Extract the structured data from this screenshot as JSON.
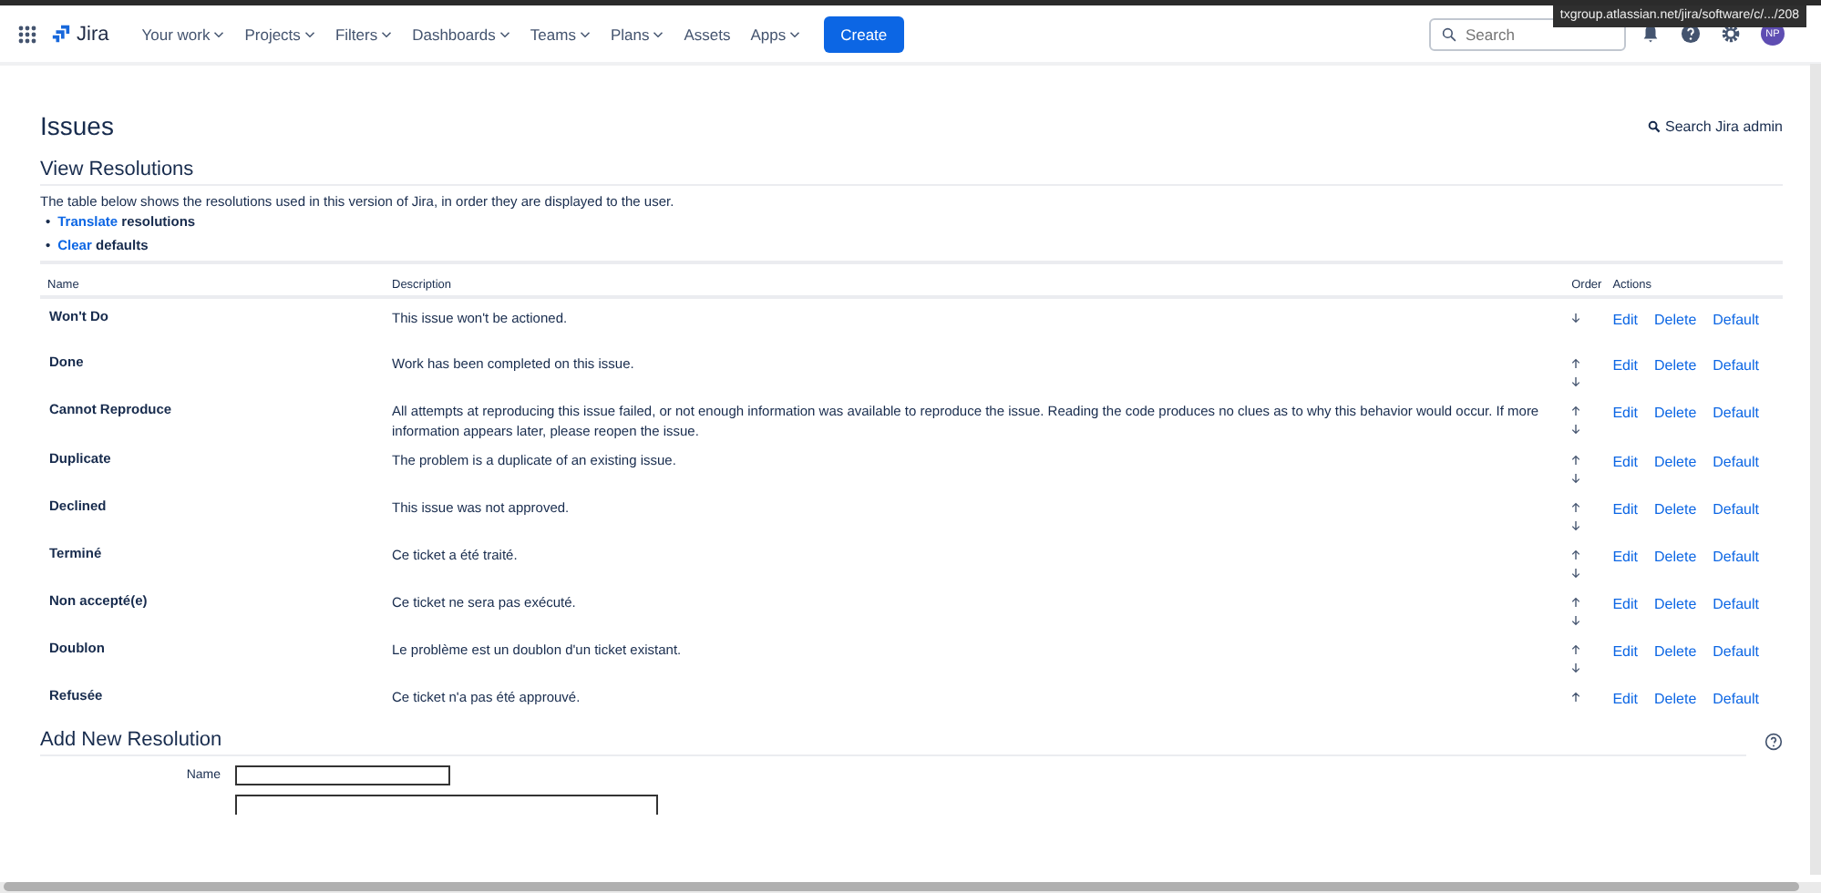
{
  "nav": {
    "logo": "Jira",
    "items": [
      {
        "label": "Your work",
        "dropdown": true
      },
      {
        "label": "Projects",
        "dropdown": true
      },
      {
        "label": "Filters",
        "dropdown": true
      },
      {
        "label": "Dashboards",
        "dropdown": true
      },
      {
        "label": "Teams",
        "dropdown": true
      },
      {
        "label": "Plans",
        "dropdown": true
      },
      {
        "label": "Assets",
        "dropdown": false
      },
      {
        "label": "Apps",
        "dropdown": true
      }
    ],
    "create": "Create",
    "search": {
      "placeholder": "Search"
    },
    "avatar": "NP"
  },
  "tooltip": {
    "url": "txgroup.atlassian.net/jira/software/c/.../208"
  },
  "page": {
    "title": "Issues",
    "admin_search": "Search Jira admin",
    "section": "View Resolutions",
    "intro": "The table below shows the resolutions used in this version of Jira, in order they are displayed to the user.",
    "links": [
      {
        "marker": "•",
        "link": "Translate",
        "rest": "resolutions"
      },
      {
        "marker": "•",
        "link": "Clear",
        "rest": "defaults"
      }
    ]
  },
  "table": {
    "columns": [
      "Name",
      "Description",
      "Order",
      "Actions"
    ],
    "rows": [
      {
        "name": "Won't Do",
        "description": "This issue won't be actioned.",
        "up": false,
        "down": true,
        "actions": [
          "Edit",
          "Delete",
          "Default"
        ]
      },
      {
        "name": "Done",
        "description": "Work has been completed on this issue.",
        "up": true,
        "down": true,
        "actions": [
          "Edit",
          "Delete",
          "Default"
        ]
      },
      {
        "name": "Cannot Reproduce",
        "description": "All attempts at reproducing this issue failed, or not enough information was available to reproduce the issue. Reading the code produces no clues as to why this behavior would occur. If more information appears later, please reopen the issue.",
        "up": true,
        "down": true,
        "actions": [
          "Edit",
          "Delete",
          "Default"
        ]
      },
      {
        "name": "Duplicate",
        "description": "The problem is a duplicate of an existing issue.",
        "up": true,
        "down": true,
        "actions": [
          "Edit",
          "Delete",
          "Default"
        ]
      },
      {
        "name": "Declined",
        "description": "This issue was not approved.",
        "up": true,
        "down": true,
        "actions": [
          "Edit",
          "Delete",
          "Default"
        ]
      },
      {
        "name": "Terminé",
        "description": "Ce ticket a été traité.",
        "up": true,
        "down": true,
        "actions": [
          "Edit",
          "Delete",
          "Default"
        ]
      },
      {
        "name": "Non accepté(e)",
        "description": "Ce ticket ne sera pas exécuté.",
        "up": true,
        "down": true,
        "actions": [
          "Edit",
          "Delete",
          "Default"
        ]
      },
      {
        "name": "Doublon",
        "description": "Le problème est un doublon d'un ticket existant.",
        "up": true,
        "down": true,
        "actions": [
          "Edit",
          "Delete",
          "Default"
        ]
      },
      {
        "name": "Refusée",
        "description": "Ce ticket n'a pas été approuvé.",
        "up": true,
        "down": false,
        "actions": [
          "Edit",
          "Delete",
          "Default"
        ]
      }
    ]
  },
  "add_form": {
    "title": "Add New Resolution",
    "fields": [
      {
        "label": "Name"
      }
    ]
  }
}
